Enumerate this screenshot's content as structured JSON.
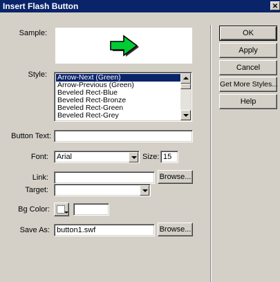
{
  "window": {
    "title": "Insert Flash Button",
    "close_glyph": "✕"
  },
  "labels": {
    "sample": "Sample:",
    "style": "Style:",
    "button_text": "Button Text:",
    "font": "Font:",
    "size": "Size:",
    "link": "Link:",
    "target": "Target:",
    "bg_color": "Bg Color:",
    "save_as": "Save As:"
  },
  "style_list": {
    "items": [
      "Arrow-Next (Green)",
      "Arrow-Previous (Green)",
      "Beveled Rect-Blue",
      "Beveled Rect-Bronze",
      "Beveled Rect-Green",
      "Beveled Rect-Grey"
    ],
    "selected_index": 0
  },
  "fields": {
    "button_text": "",
    "font": "Arial",
    "size": "15",
    "link": "",
    "target": "",
    "bg_color_hex": "",
    "save_as": "button1.swf"
  },
  "buttons": {
    "ok": "OK",
    "apply": "Apply",
    "cancel": "Cancel",
    "get_more_styles": "Get More Styles...",
    "help": "Help",
    "browse_link": "Browse...",
    "browse_save": "Browse..."
  },
  "colors": {
    "arrow_fill": "#00cc33",
    "arrow_outline": "#000000",
    "title_bg": "#0a246a"
  },
  "icons": {
    "sample": "green-right-arrow",
    "bg_color": "color-picker-swatch"
  }
}
